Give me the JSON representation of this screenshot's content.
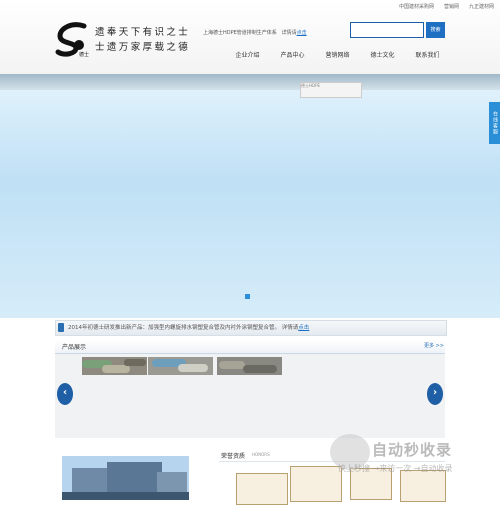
{
  "top_links": [
    "中国建材采购网",
    "营销网",
    "九正建材网"
  ],
  "logo": {
    "label": "德士"
  },
  "slogan": {
    "line1": "遗奉天下有识之士",
    "line2": "士遗万家厚载之德"
  },
  "hotline": {
    "text": "上海德士HDPE管道排制生产体系",
    "link_prefix": "详情请",
    "link": "点击"
  },
  "search": {
    "placeholder": "",
    "button": "搜索"
  },
  "nav": [
    "企业介绍",
    "产品中心",
    "营销网络",
    "德士文化",
    "联系我们"
  ],
  "banner": {
    "thumb_text": "德士HDPE"
  },
  "side_tab": "在线客服",
  "news": {
    "text": "2014年初德士研发推出新产品：加强型内螺旋排水钢塑复合管及内衬外涂钢塑复合管。  详情请",
    "link": "点击"
  },
  "products": {
    "title": "产品展示",
    "more": "更多 >>"
  },
  "honor": {
    "title": "荣誉资质",
    "subtitle": "HONORS"
  },
  "watermark": {
    "main": "自动秒收录",
    "sub": "快上秒搜 →来访一次 →自动收录"
  },
  "colors": {
    "accent": "#1f6fc3",
    "banner": "#cfe8f8"
  }
}
